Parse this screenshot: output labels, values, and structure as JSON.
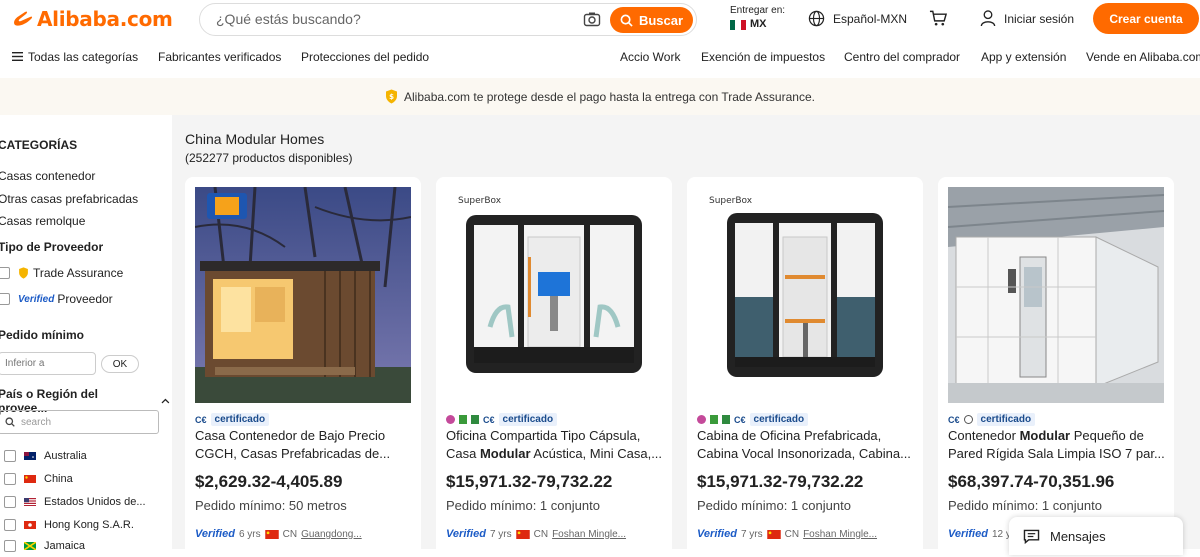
{
  "header": {
    "logo_text": "Alibaba.com",
    "search_placeholder": "¿Qué estás buscando?",
    "search_button": "Buscar",
    "deliver_label": "Entregar en:",
    "deliver_country": "MX",
    "language": "Español-MXN",
    "login": "Iniciar sesión",
    "create_account": "Crear cuenta"
  },
  "nav": {
    "all_categories": "Todas las categorías",
    "verified_manufacturers": "Fabricantes verificados",
    "order_protections": "Protecciones del pedido",
    "accio_work": "Accio Work",
    "tax_exemption": "Exención de impuestos",
    "buyer_center": "Centro del comprador",
    "app_extension": "App y extensión",
    "sell": "Vende en Alibaba.com"
  },
  "banner": {
    "text": "Alibaba.com te protege desde el pago hasta la entrega con Trade Assurance."
  },
  "sidebar": {
    "categories_title": "CATEGORÍAS",
    "categories": [
      "Casas contenedor",
      "Otras casas prefabricadas",
      "Casas remolque"
    ],
    "supplier_type_title": "Tipo de Proveedor",
    "trade_assurance": "Trade Assurance",
    "verified_logo": "Verified",
    "verified_supplier": "Proveedor",
    "min_order_title": "Pedido mínimo",
    "min_order_placeholder": "Inferior a",
    "ok": "OK",
    "region_title": "País o Región del provee...",
    "search_placeholder": "search",
    "countries": [
      "Australia",
      "China",
      "Estados Unidos de...",
      "Hong Kong S.A.R.",
      "Jamaica"
    ]
  },
  "results": {
    "title": "China Modular Homes",
    "count": "(252277 productos disponibles)"
  },
  "products": [
    {
      "cert": "certificado",
      "title_a": "Casa Contenedor de Bajo Precio CGCH, Casas Prefabricadas de...",
      "title_b": "",
      "title_c": "",
      "price": "$2,629.32-4,405.89",
      "moq": "Pedido mínimo: 50 metros",
      "years": "6 yrs",
      "country": "CN",
      "supplier": "Guangdong..."
    },
    {
      "cert": "certificado",
      "brand": "SuperBox",
      "title_a": "Oficina Compartida Tipo Cápsula, Casa ",
      "title_b": "Modular",
      "title_c": " Acústica, Mini Casa,...",
      "price": "$15,971.32-79,732.22",
      "moq": "Pedido mínimo: 1 conjunto",
      "years": "7 yrs",
      "country": "CN",
      "supplier": "Foshan Mingle..."
    },
    {
      "cert": "certificado",
      "brand": "SuperBox",
      "title_a": "Cabina de Oficina Prefabricada, Cabina Vocal Insonorizada, Cabina...",
      "title_b": "",
      "title_c": "",
      "price": "$15,971.32-79,732.22",
      "moq": "Pedido mínimo: 1 conjunto",
      "years": "7 yrs",
      "country": "CN",
      "supplier": "Foshan Mingle..."
    },
    {
      "cert": "certificado",
      "title_a": "Contenedor ",
      "title_b": "Modular",
      "title_c": " Pequeño de Pared Rígida Sala Limpia ISO 7 par...",
      "price": "$68,397.74-70,351.96",
      "moq": "Pedido mínimo: 1 conjunto",
      "years": "12 y",
      "country": "",
      "supplier": ""
    }
  ],
  "verified_word": "Verified",
  "messages": "Mensajes",
  "colors": {
    "accent": "#ff6a00",
    "verified_blue": "#1c5bc6"
  }
}
